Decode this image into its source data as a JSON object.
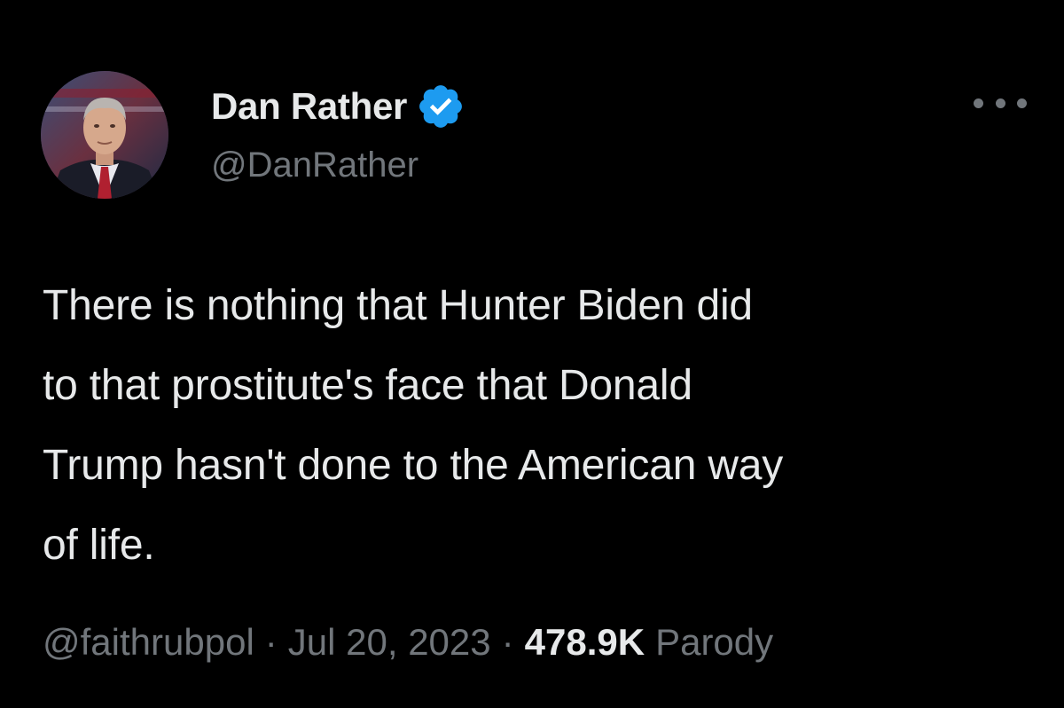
{
  "author": {
    "display_name": "Dan Rather",
    "handle": "@DanRather",
    "verified_icon": "verified-badge-icon",
    "verified_color": "#1d9bf0"
  },
  "menu": {
    "icon": "more-options-icon"
  },
  "tweet": {
    "lines": [
      "There is nothing that Hunter Biden did",
      "to that prostitute's face that Donald",
      "Trump hasn't done to the American way",
      "of life."
    ]
  },
  "footer": {
    "source_handle": "@faithrubpol",
    "separator": "·",
    "date": "Jul 20, 2023",
    "views_count": "478.9K",
    "views_label": "Parody"
  },
  "colors": {
    "background": "#000000",
    "primary_text": "#e7e9ea",
    "secondary_text": "#71767b"
  }
}
